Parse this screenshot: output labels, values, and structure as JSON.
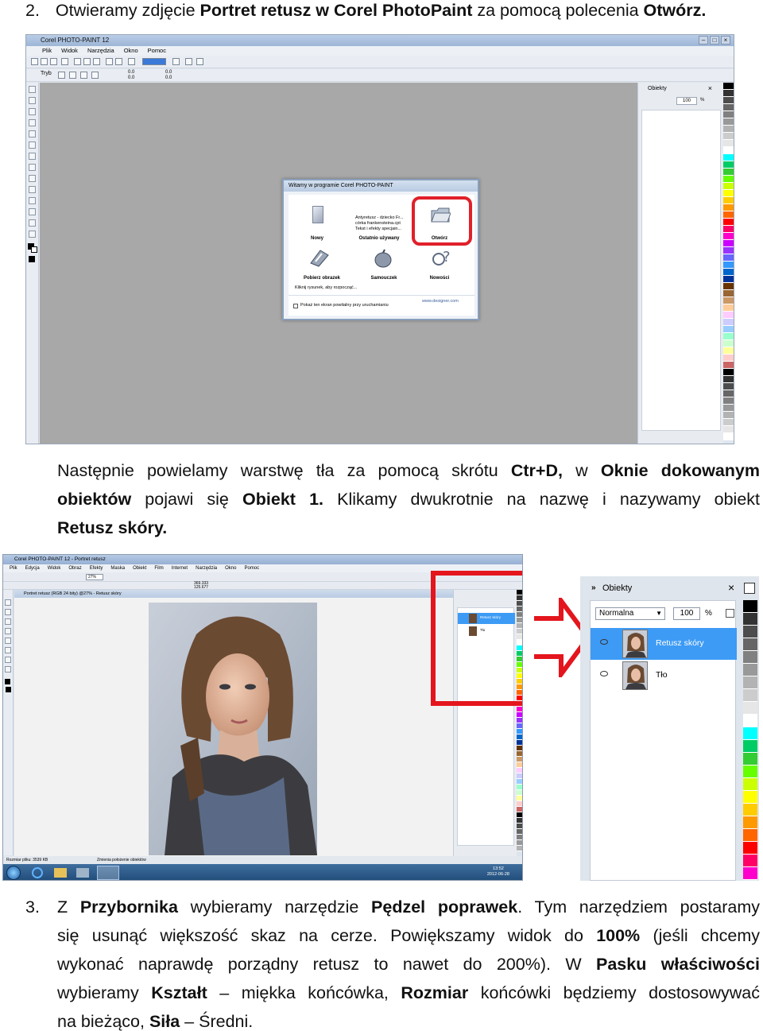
{
  "step2": {
    "prefix": "2.",
    "text_a": "Otwieramy zdjęcie ",
    "bold_a": "Portret retusz w Corel PhotoPaint",
    "text_b": " za pomocą polecenia ",
    "bold_b": "Otwórz."
  },
  "screenshot1": {
    "app_title": "Corel PHOTO-PAINT 12",
    "menu": [
      "Plik",
      "Widok",
      "Narzędzia",
      "Okno",
      "Pomoc"
    ],
    "toolbar_mode_label": "Tryb",
    "toolbar_values": [
      "0.0",
      "0.0",
      "0.0",
      "0.0"
    ],
    "dock_title": "Obiekty",
    "dock_opacity": "100",
    "dock_pct": "%",
    "welcome": {
      "title": "Witamy w programie Corel PHOTO-PAINT",
      "new_label": "Nowy",
      "recent_label": "Ostatnio używany",
      "open_label": "Otwórz",
      "recent_items": [
        "Antyretusz - dziecko Fr...",
        "córka frankensteina.cpt",
        "Tekst i efekty specjain..."
      ],
      "acquire_label": "Pobierz obrazek",
      "tutor_label": "Samouczek",
      "news_label": "Nowości",
      "hint": "Kliknij rysunek, aby rozpocząć...",
      "checkbox_label": "Pokaż ten ekran powitalny przy uruchamianiu",
      "url": "www.designer.com"
    }
  },
  "para2": {
    "line1": [
      {
        "t": "Następnie powielamy warstwę tła za pomocą skrótu ",
        "b": false
      },
      {
        "t": "Ctr+D,",
        "b": true
      },
      {
        "t": " w ",
        "b": false
      },
      {
        "t": "Oknie dokowanym",
        "b": true
      }
    ],
    "line2": [
      {
        "t": "obiektów",
        "b": true
      },
      {
        "t": " pojawi się ",
        "b": false
      },
      {
        "t": "Obiekt 1.",
        "b": true
      },
      {
        "t": " Klikamy dwukrotnie na nazwę i nazywamy obiekt",
        "b": false
      }
    ],
    "line3": [
      {
        "t": "Retusz skóry.",
        "b": true
      }
    ]
  },
  "screenshot2": {
    "app_title": "Corel PHOTO-PAINT 12 - Portret retusz",
    "menu": [
      "Plik",
      "Edycja",
      "Widok",
      "Obraz",
      "Efekty",
      "Maska",
      "Obiekt",
      "Film",
      "Internet",
      "Narzędzia",
      "Okno",
      "Pomoc"
    ],
    "zoom_value": "27%",
    "coords": [
      "369.333",
      "125.677"
    ],
    "doc_title": "Portret retusz (RGB 24 bity) @27% - Retusz skóry",
    "layers_small": [
      "Retusz skóry",
      "Tło"
    ],
    "status_left": "Rozmiar pliku: 3539 KB",
    "status_mid": "Zmienia położenie obiektów",
    "clock_time": "13:52",
    "clock_date": "2012-06-28"
  },
  "zoom_panel": {
    "title": "Obiekty",
    "mode": "Normalna",
    "opacity": "100",
    "pct": "%",
    "layers": [
      {
        "name": "Retusz skóry",
        "selected": true
      },
      {
        "name": "Tło",
        "selected": false
      }
    ]
  },
  "step3": {
    "line1": [
      {
        "t": "3.",
        "b": false
      },
      {
        "t": "Z ",
        "b": false
      },
      {
        "t": "Przybornika",
        "b": true
      },
      {
        "t": " wybieramy narzędzie ",
        "b": false
      },
      {
        "t": "Pędzel poprawek",
        "b": true
      },
      {
        "t": ". Tym narzędziem postaramy",
        "b": false
      }
    ],
    "line2": [
      {
        "t": "się usunąć większość skaz na cerze. Powiększamy widok do ",
        "b": false
      },
      {
        "t": "100%",
        "b": true
      },
      {
        "t": " (jeśli chcemy",
        "b": false
      }
    ],
    "line3": [
      {
        "t": "wykonać naprawdę porządny retusz to nawet do 200%). W ",
        "b": false
      },
      {
        "t": "Pasku właściwości",
        "b": true
      }
    ],
    "line4": [
      {
        "t": "wybieramy ",
        "b": false
      },
      {
        "t": "Kształt",
        "b": true
      },
      {
        "t": " – miękka końcówka, ",
        "b": false
      },
      {
        "t": "Rozmiar",
        "b": true
      },
      {
        "t": " końcówki będziemy dostosowywać",
        "b": false
      }
    ],
    "line5": [
      {
        "t": "na bieżąco, ",
        "b": false
      },
      {
        "t": "Siła",
        "b": true
      },
      {
        "t": " – Średni.",
        "b": false
      }
    ]
  },
  "colors": {
    "highlight_red": "#e4151c",
    "selection_blue": "#3d9bf5",
    "canvas_gray": "#a8a8a8"
  }
}
